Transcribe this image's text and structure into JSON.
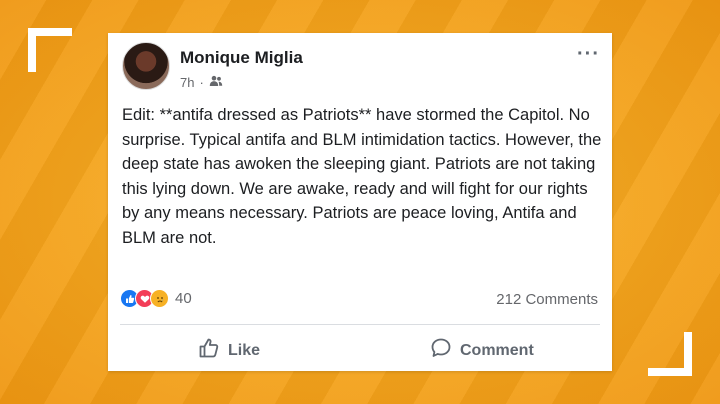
{
  "post": {
    "author_name": "Monique Miglia",
    "time": "7h",
    "separator": "·",
    "audience_icon": "friends-icon",
    "more_label": "···",
    "text": "Edit: **antifa dressed as Patriots** have stormed the Capitol. No surprise. Typical antifa and BLM intimidation tactics. However, the deep state has awoken the sleeping giant. Patriots are not taking this lying down. We are awake, ready and will fight for our rights by any means necessary. Patriots are peace loving, Antifa and BLM are not.",
    "reactions": {
      "icons": [
        "like-reaction-icon",
        "love-reaction-icon",
        "sad-reaction-icon"
      ],
      "count": "40"
    },
    "comments_count": "212 Comments",
    "actions": {
      "like_label": "Like",
      "comment_label": "Comment"
    }
  },
  "colors": {
    "background": "#f5a623",
    "facebook_blue": "#1877f2",
    "frame": "#ffffff"
  }
}
